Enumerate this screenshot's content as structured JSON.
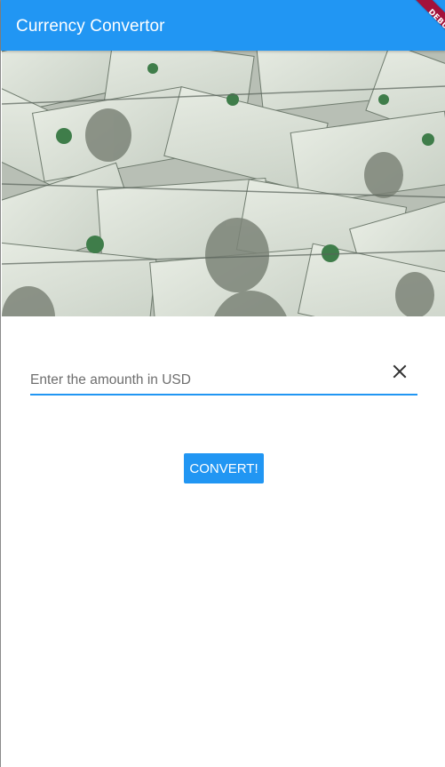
{
  "appbar": {
    "title": "Currency Convertor",
    "color": "#2196f3"
  },
  "debug_banner": {
    "label": "DEBUG",
    "color": "#a3123b"
  },
  "hero": {
    "image": "dollar-bills-photo"
  },
  "amount_field": {
    "placeholder": "Enter the amounth in USD",
    "value": "",
    "clear_icon": "close-icon"
  },
  "convert_button": {
    "label": "CONVERT!"
  }
}
